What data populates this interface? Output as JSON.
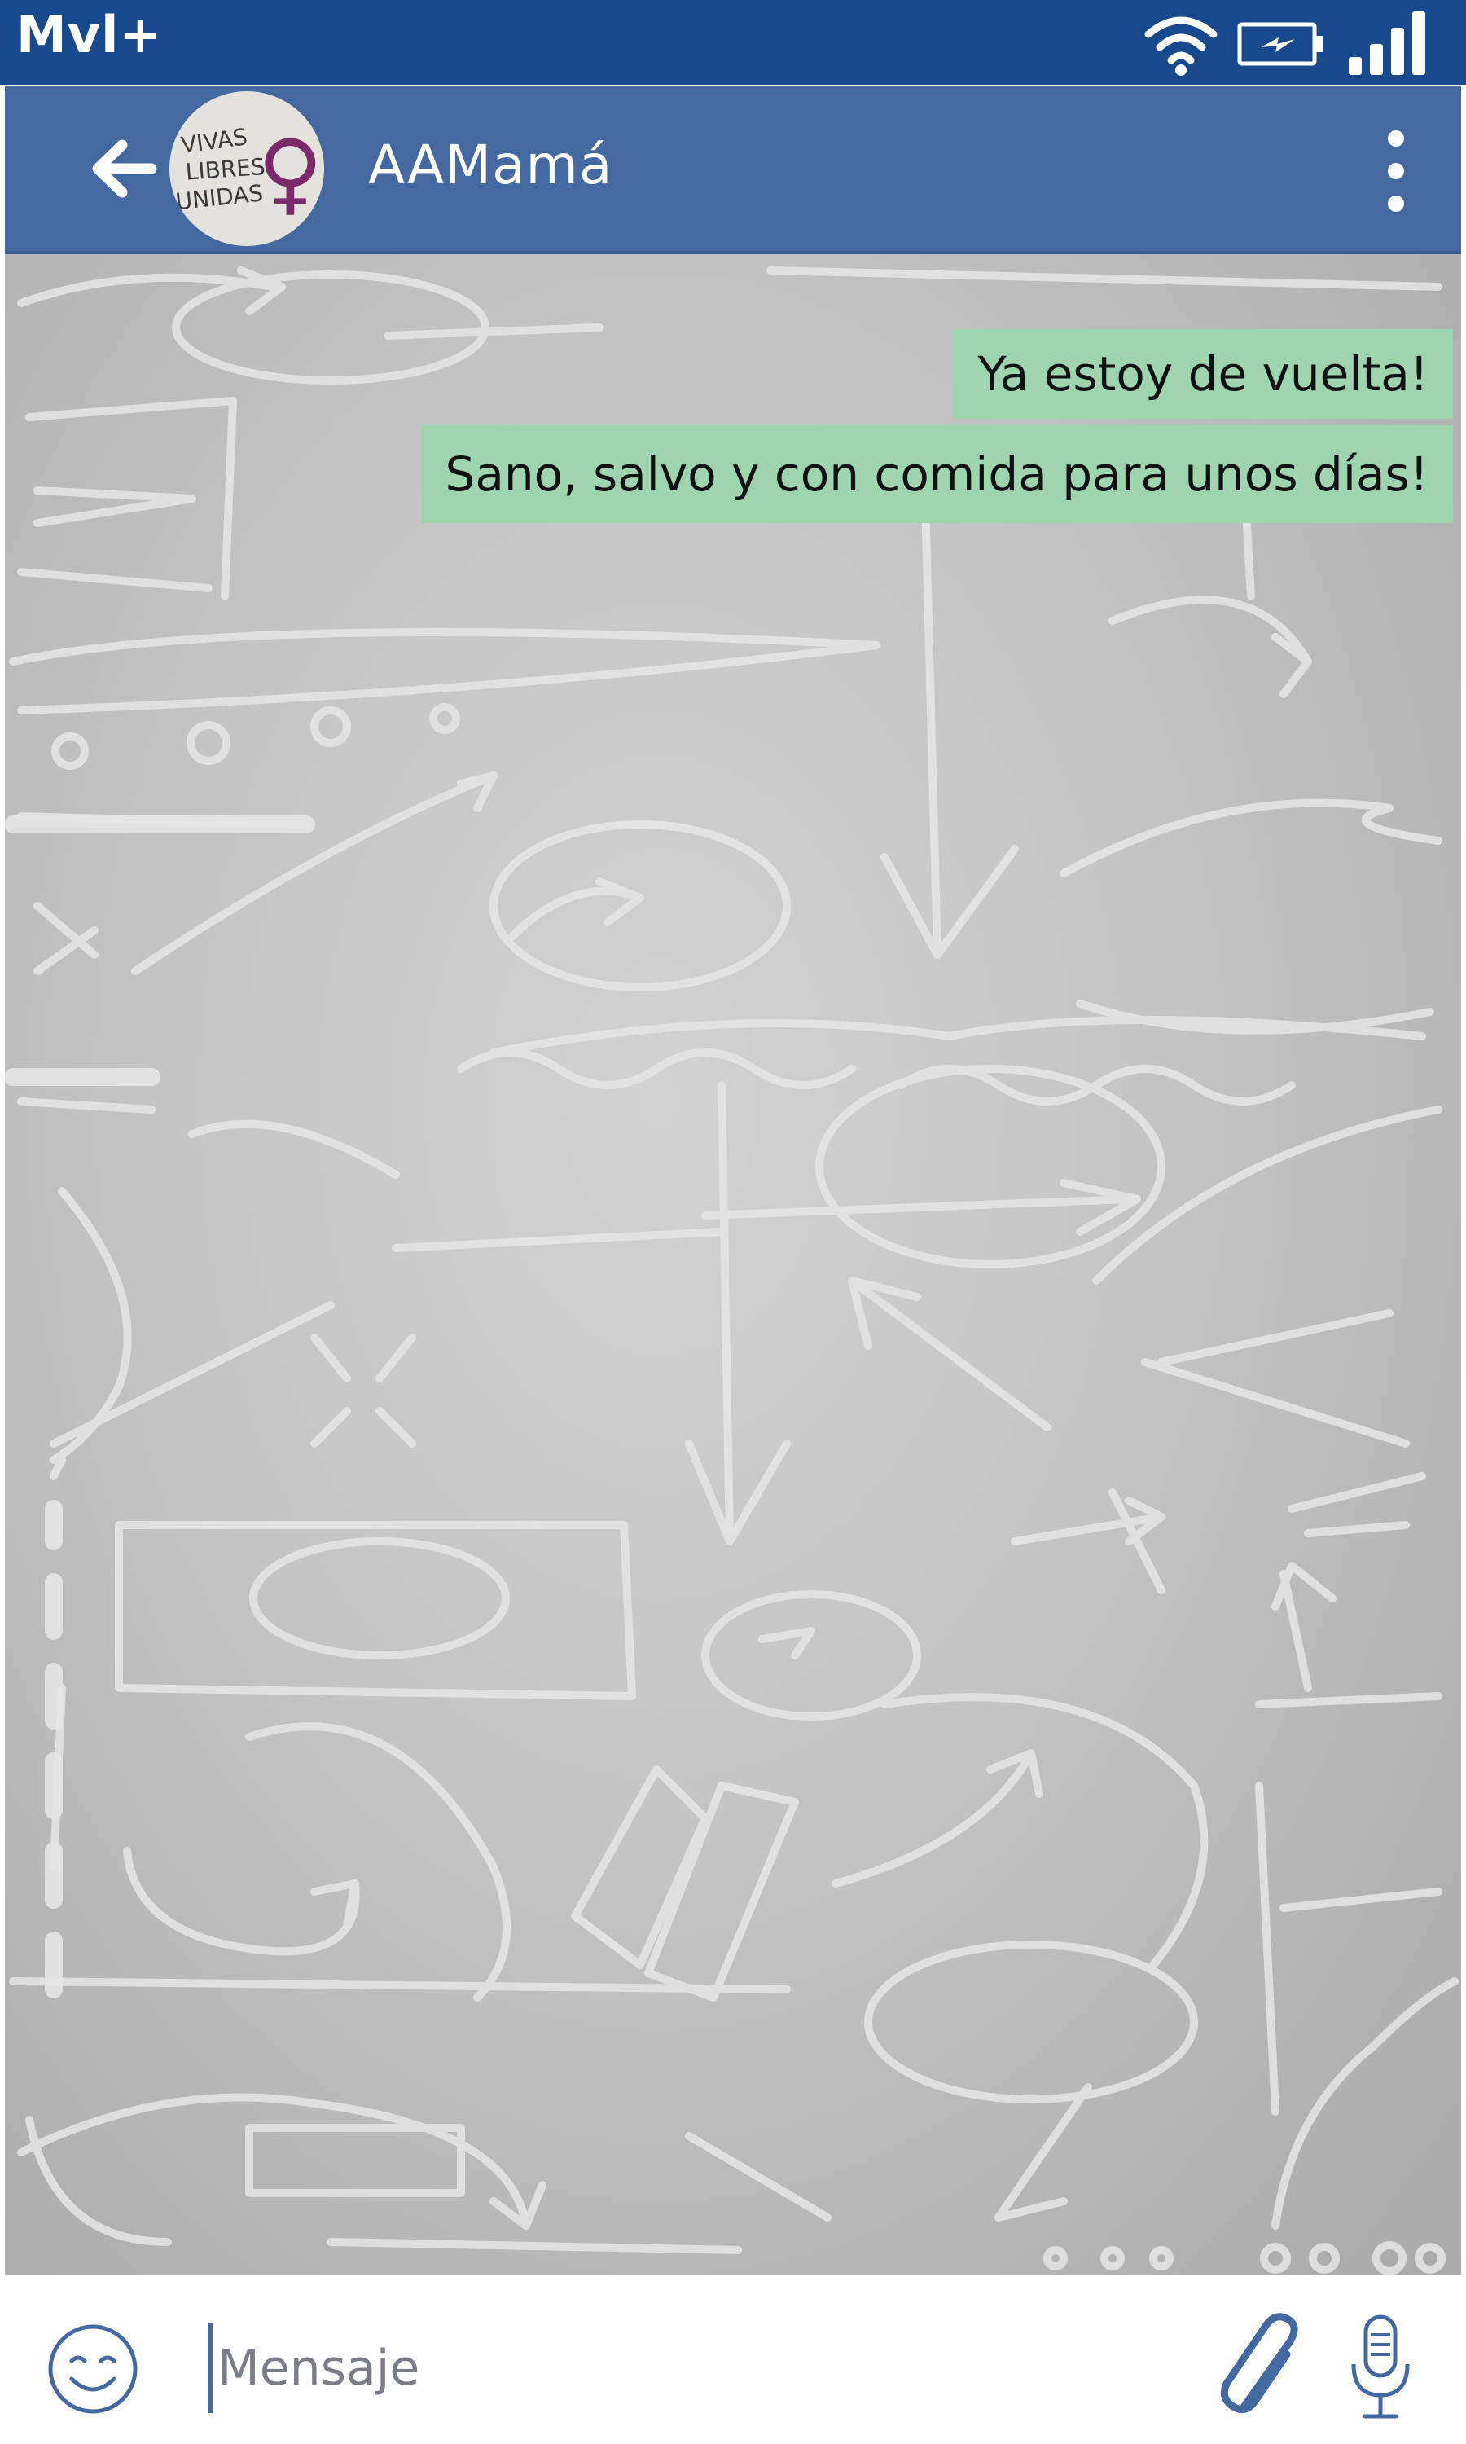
{
  "status_bar": {
    "carrier": "Mvl+",
    "icons": [
      "wifi-icon",
      "battery-charging-icon",
      "signal-icon"
    ],
    "background_color": "#18498c"
  },
  "header": {
    "contact_name": "AAMamá",
    "avatar": {
      "lines": [
        "VIVAS",
        "LIBRES",
        "UNIDAS"
      ],
      "symbol": "♀"
    },
    "icons": [
      "back-arrow-icon",
      "more-vert-icon"
    ],
    "background_color": "#4469a0"
  },
  "messages": [
    {
      "direction": "outgoing",
      "text": "Ya estoy de vuelta!"
    },
    {
      "direction": "outgoing",
      "text": "Sano, salvo y con comida para unos días!"
    }
  ],
  "message_bubble_color": "#9ed4ae",
  "input_bar": {
    "placeholder": "Mensaje",
    "value": "",
    "icons": [
      "emoji-icon",
      "paperclip-icon",
      "microphone-icon"
    ],
    "accent_color": "#4469a0"
  }
}
